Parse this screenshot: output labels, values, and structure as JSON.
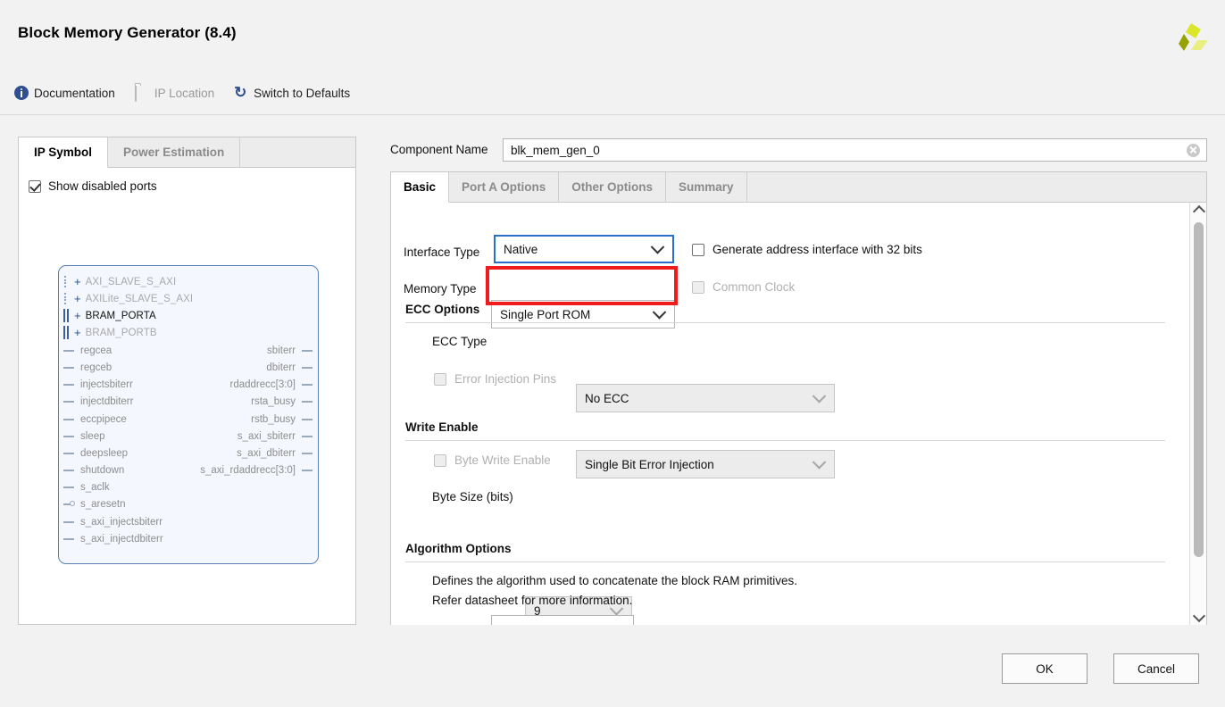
{
  "window": {
    "title": "Block Memory Generator (8.4)",
    "logo_icon": "xilinx-logo-icon"
  },
  "toolbar": {
    "items": [
      {
        "label": "Documentation",
        "icon": "info-icon",
        "enabled": true
      },
      {
        "label": "IP Location",
        "icon": "folder-icon",
        "enabled": false
      },
      {
        "label": "Switch to Defaults",
        "icon": "refresh-icon",
        "enabled": true
      }
    ]
  },
  "left_panel": {
    "tabs": [
      {
        "label": "IP Symbol",
        "active": true
      },
      {
        "label": "Power Estimation",
        "active": false
      }
    ],
    "show_disabled_ports": {
      "label": "Show disabled ports",
      "checked": true
    },
    "symbol": {
      "buses": [
        {
          "name": "AXI_SLAVE_S_AXI",
          "enabled": false,
          "connector": "dots"
        },
        {
          "name": "AXILite_SLAVE_S_AXI",
          "enabled": false,
          "connector": "dots"
        },
        {
          "name": "BRAM_PORTA",
          "enabled": true,
          "connector": "solid"
        },
        {
          "name": "BRAM_PORTB",
          "enabled": false,
          "connector": "solid"
        }
      ],
      "left_pins": [
        {
          "name": "regcea",
          "inverted": false
        },
        {
          "name": "regceb",
          "inverted": false
        },
        {
          "name": "injectsbiterr",
          "inverted": false
        },
        {
          "name": "injectdbiterr",
          "inverted": false
        },
        {
          "name": "eccpipece",
          "inverted": false
        },
        {
          "name": "sleep",
          "inverted": false
        },
        {
          "name": "deepsleep",
          "inverted": false
        },
        {
          "name": "shutdown",
          "inverted": false
        },
        {
          "name": "s_aclk",
          "inverted": false
        },
        {
          "name": "s_aresetn",
          "inverted": true
        },
        {
          "name": "s_axi_injectsbiterr",
          "inverted": false
        },
        {
          "name": "s_axi_injectdbiterr",
          "inverted": false
        }
      ],
      "right_pins": [
        {
          "name": "sbiterr"
        },
        {
          "name": "dbiterr"
        },
        {
          "name": "rdaddrecc[3:0]"
        },
        {
          "name": "rsta_busy"
        },
        {
          "name": "rstb_busy"
        },
        {
          "name": "s_axi_sbiterr"
        },
        {
          "name": "s_axi_dbiterr"
        },
        {
          "name": "s_axi_rdaddrecc[3:0]"
        }
      ]
    }
  },
  "component": {
    "label": "Component Name",
    "value": "blk_mem_gen_0",
    "clear_icon": "clear-icon"
  },
  "right_panel": {
    "tabs": [
      {
        "label": "Basic",
        "active": true
      },
      {
        "label": "Port A Options",
        "active": false
      },
      {
        "label": "Other Options",
        "active": false
      },
      {
        "label": "Summary",
        "active": false
      }
    ],
    "interface_type": {
      "label": "Interface Type",
      "value": "Native",
      "focused": true
    },
    "generate_address": {
      "label": "Generate address interface with 32 bits",
      "checked": false,
      "enabled": true
    },
    "memory_type": {
      "label": "Memory Type",
      "value": "Single Port ROM",
      "highlighted": true
    },
    "common_clock": {
      "label": "Common Clock",
      "checked": false,
      "enabled": false
    },
    "ecc_options": {
      "title": "ECC Options",
      "ecc_type": {
        "label": "ECC Type",
        "value": "No ECC",
        "enabled": false
      },
      "error_injection_pins": {
        "label": "Error Injection Pins",
        "checked": false,
        "enabled": false
      },
      "error_injection_type": {
        "value": "Single Bit Error Injection",
        "enabled": false
      }
    },
    "write_enable": {
      "title": "Write Enable",
      "byte_write_enable": {
        "label": "Byte Write Enable",
        "checked": false,
        "enabled": false
      },
      "byte_size": {
        "label": "Byte Size (bits)",
        "value": "9",
        "enabled": false
      }
    },
    "algorithm_options": {
      "title": "Algorithm Options",
      "note_line1": "Defines the algorithm used to concatenate the block RAM primitives.",
      "note_line2": "Refer datasheet for more information."
    },
    "scrollbar": {
      "up_icon": "chevron-up-icon",
      "down_icon": "chevron-down-icon"
    }
  },
  "footer": {
    "ok_label": "OK",
    "cancel_label": "Cancel"
  },
  "colors": {
    "accent_blue": "#2a6fc9",
    "highlight_red": "#ee1c1c",
    "symbol_border": "#5b7fb5",
    "logo_green": "#c8d419"
  }
}
